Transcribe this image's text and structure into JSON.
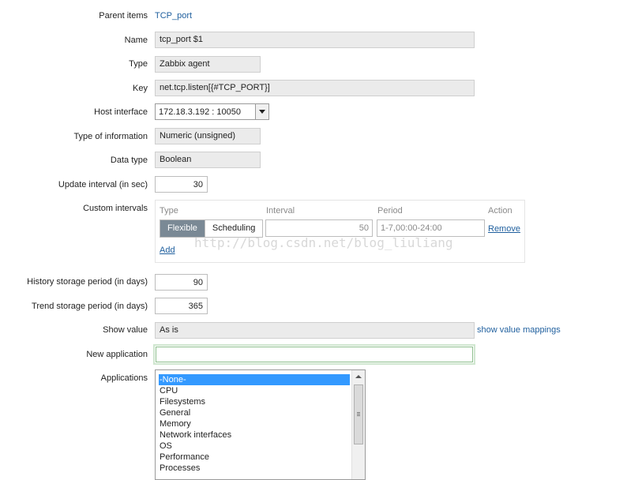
{
  "form": {
    "parent_items": {
      "label": "Parent items",
      "value": "TCP_port"
    },
    "name": {
      "label": "Name",
      "value": "tcp_port $1"
    },
    "type": {
      "label": "Type",
      "value": "Zabbix agent"
    },
    "key": {
      "label": "Key",
      "value": "net.tcp.listen[{#TCP_PORT}]"
    },
    "host_interface": {
      "label": "Host interface",
      "value": "172.18.3.192 : 10050"
    },
    "type_of_information": {
      "label": "Type of information",
      "value": "Numeric (unsigned)"
    },
    "data_type": {
      "label": "Data type",
      "value": "Boolean"
    },
    "update_interval": {
      "label": "Update interval (in sec)",
      "value": "30"
    },
    "custom_intervals": {
      "label": "Custom intervals",
      "headers": {
        "type": "Type",
        "interval": "Interval",
        "period": "Period",
        "action": "Action"
      },
      "row": {
        "flexible": "Flexible",
        "scheduling": "Scheduling",
        "interval": "50",
        "period": "1-7,00:00-24:00",
        "remove": "Remove"
      },
      "add": "Add"
    },
    "history": {
      "label": "History storage period (in days)",
      "value": "90"
    },
    "trend": {
      "label": "Trend storage period (in days)",
      "value": "365"
    },
    "show_value": {
      "label": "Show value",
      "value": "As is",
      "link": "show value mappings"
    },
    "new_application": {
      "label": "New application",
      "value": ""
    },
    "applications": {
      "label": "Applications",
      "items": [
        "-None-",
        "CPU",
        "Filesystems",
        "General",
        "Memory",
        "Network interfaces",
        "OS",
        "Performance",
        "Processes"
      ],
      "selected": "-None-"
    }
  },
  "watermark": "http://blog.csdn.net/blog_liuliang",
  "colors": {
    "link": "#1f5f9e",
    "selected": "#3399ff",
    "toggle_on": "#7a8995",
    "focus": "#8fbf8f"
  }
}
